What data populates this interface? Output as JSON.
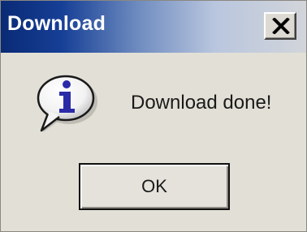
{
  "window": {
    "title": "Download",
    "close_icon": "close-x-icon"
  },
  "body": {
    "icon": "information-icon",
    "message": "Download done!"
  },
  "buttons": {
    "ok_label": "OK"
  },
  "colors": {
    "title_start": "#0a2a75",
    "title_end": "#d2d5da",
    "dialog_bg": "#e2e0d6",
    "info_letter": "#2b2ba8"
  }
}
